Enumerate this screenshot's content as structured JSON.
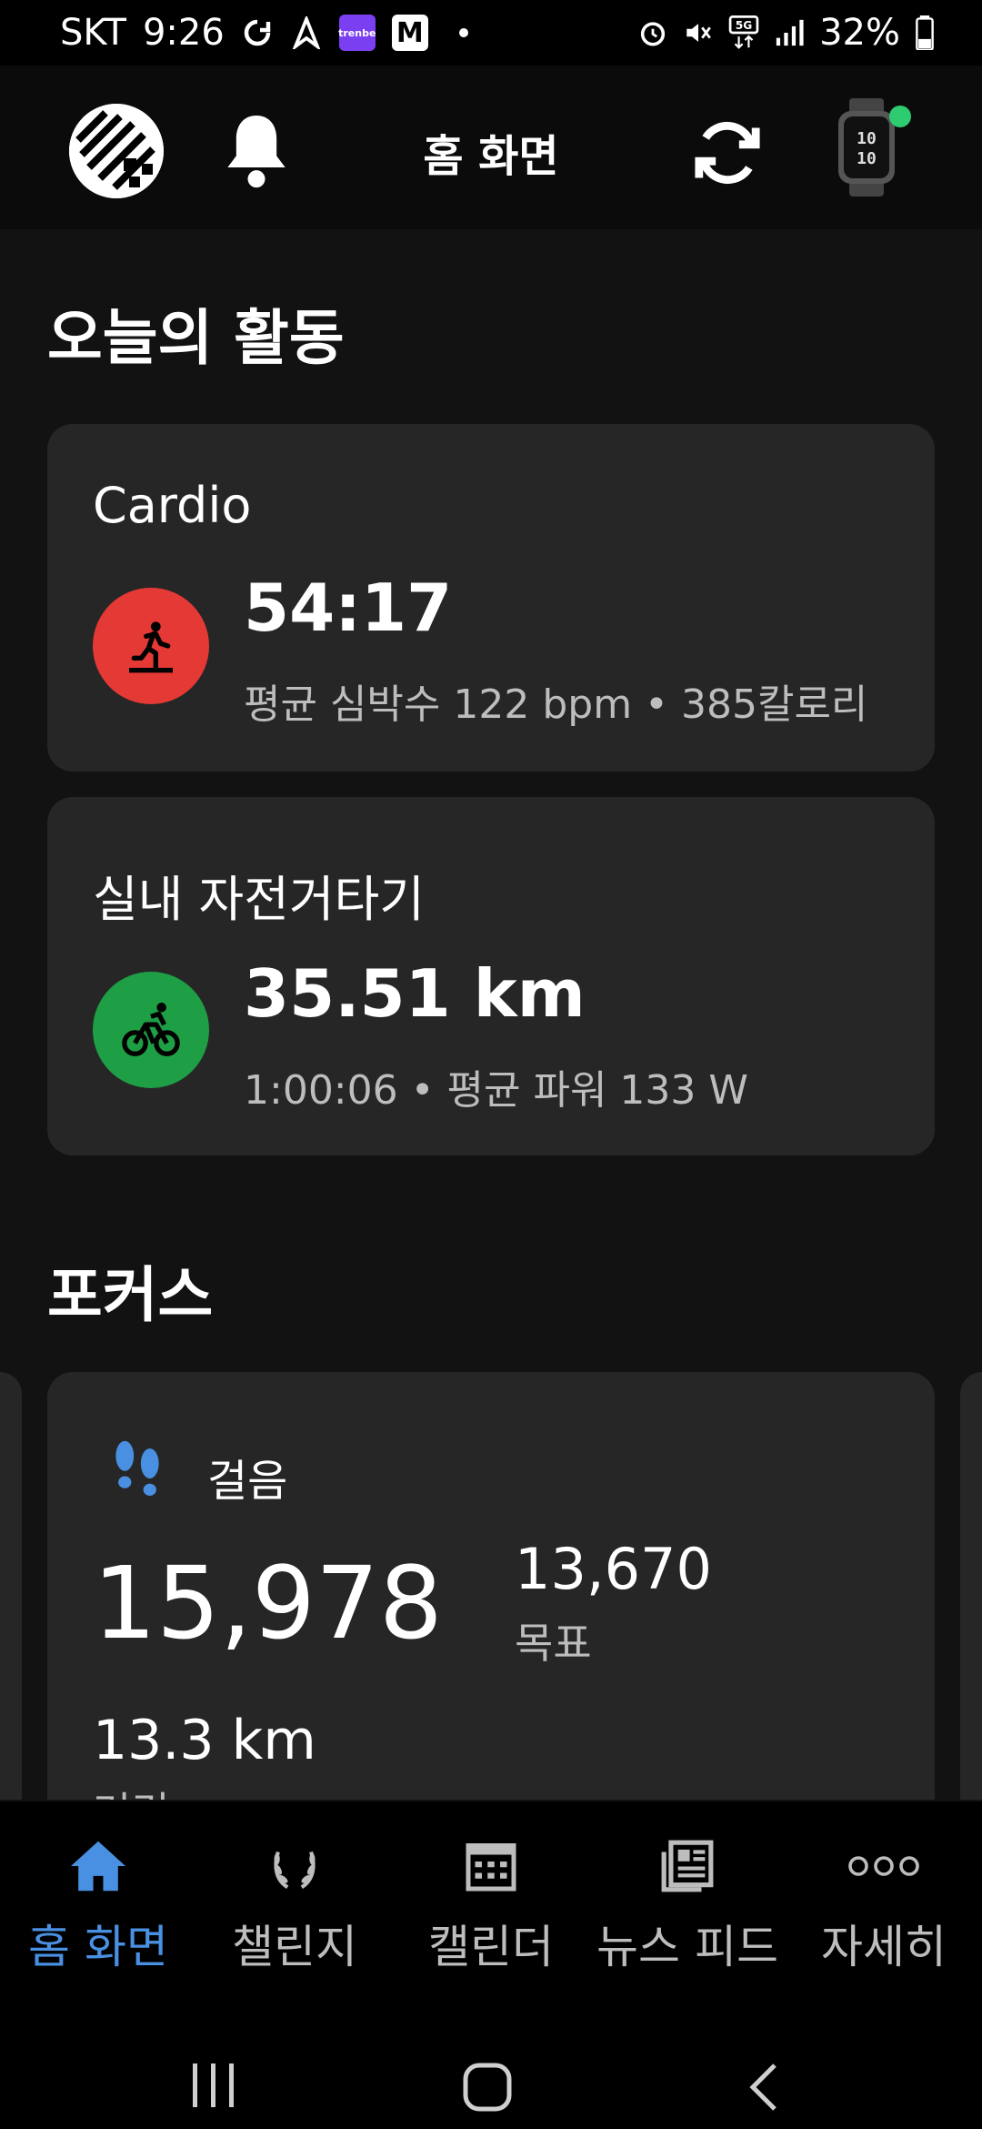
{
  "status_bar": {
    "carrier": "SKT",
    "time": "9:26",
    "battery": "32%",
    "badge_text": "trenbe",
    "m_icon": "M"
  },
  "app_bar": {
    "title": "홈 화면"
  },
  "today": {
    "section_title": "오늘의 활동",
    "activities": [
      {
        "name": "Cardio",
        "main_value": "54:17",
        "detail": "평균 심박수 122 bpm • 385칼로리",
        "icon": "running-icon",
        "color": "#e53935"
      },
      {
        "name": "실내 자전거타기",
        "main_value": "35.51 km",
        "detail": "1:00:06 • 평균 파워 133 W",
        "icon": "bike-icon",
        "color": "#1e9e45"
      }
    ]
  },
  "focus": {
    "section_title": "포커스",
    "steps_card": {
      "label": "걸음",
      "steps": "15,978",
      "goal_value": "13,670",
      "goal_label": "목표",
      "distance": "13.3 km",
      "distance_label": "거리"
    }
  },
  "bottom_nav": {
    "items": [
      {
        "label": "홈 화면",
        "icon": "home-icon",
        "active": true
      },
      {
        "label": "챌린지",
        "icon": "laurel-icon",
        "active": false
      },
      {
        "label": "캘린더",
        "icon": "calendar-icon",
        "active": false
      },
      {
        "label": "뉴스 피드",
        "icon": "newsfeed-icon",
        "active": false
      },
      {
        "label": "자세히",
        "icon": "more-icon",
        "active": false
      }
    ]
  },
  "colors": {
    "accent": "#4a90e2",
    "card_bg": "#262626",
    "watch_connected": "#2ecc71"
  }
}
